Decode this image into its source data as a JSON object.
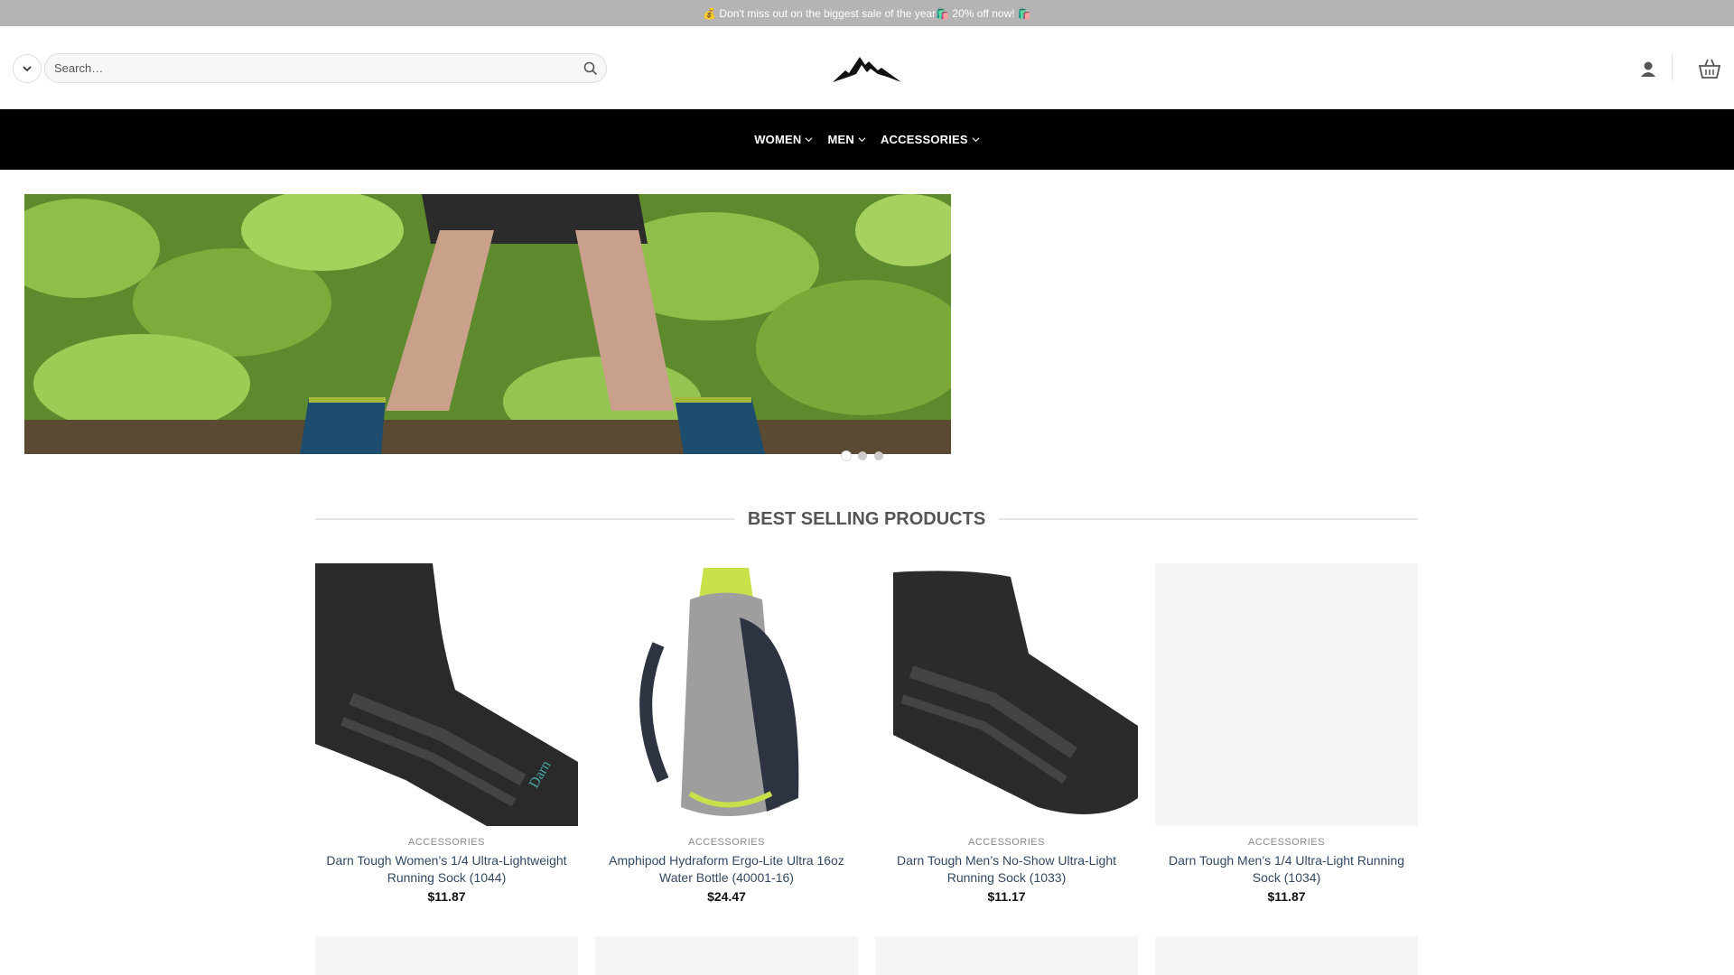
{
  "topbar": {
    "text": "💰 Don't miss out on the biggest sale of the year🛍️ 20% off now! 🛍️"
  },
  "header": {
    "search_placeholder": "Search…"
  },
  "nav": {
    "items": [
      "WOMEN",
      "MEN",
      "ACCESSORIES"
    ]
  },
  "section": {
    "title": "BEST SELLING PRODUCTS"
  },
  "products": [
    {
      "category": "ACCESSORIES",
      "name": "Darn Tough Women’s 1/4 Ultra-Lightweight Running Sock (1044)",
      "price": "$11.87"
    },
    {
      "category": "ACCESSORIES",
      "name": "Amphipod Hydraform Ergo-Lite Ultra 16oz Water Bottle (40001-16)",
      "price": "$24.47"
    },
    {
      "category": "ACCESSORIES",
      "name": "Darn Tough Men’s No-Show Ultra-Light Running Sock (1033)",
      "price": "$11.17"
    },
    {
      "category": "ACCESSORIES",
      "name": "Darn Tough Men’s 1/4 Ultra-Light Running Sock (1034)",
      "price": "$11.87"
    }
  ],
  "colors": {
    "nav_bg": "#000000",
    "topbar_bg": "#b4b4b4",
    "link": "#334862"
  },
  "icons": [
    "chevron-down-icon",
    "search-icon",
    "mountain-logo",
    "account-icon",
    "cart-icon"
  ]
}
